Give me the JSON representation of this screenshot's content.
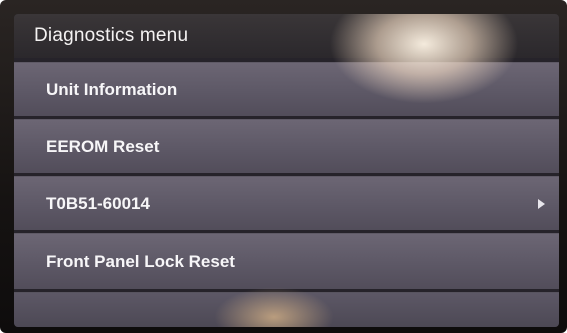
{
  "header": {
    "title": "Diagnostics menu"
  },
  "menu": {
    "items": [
      {
        "label": "Unit Information",
        "has_submenu": false
      },
      {
        "label": "EEROM Reset",
        "has_submenu": false
      },
      {
        "label": "T0B51-60014",
        "has_submenu": true
      },
      {
        "label": "Front Panel Lock Reset",
        "has_submenu": false
      }
    ],
    "arrow_icon": "chevron-right-icon"
  },
  "colors": {
    "header_bg": "#2b282c",
    "item_bg": "#5d5866",
    "text": "#f7f6f8"
  }
}
